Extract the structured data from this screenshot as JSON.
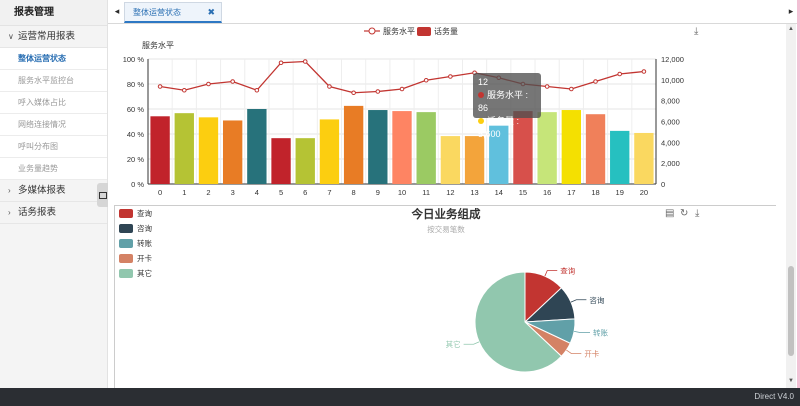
{
  "sidebar": {
    "title": "报表管理",
    "groups": [
      {
        "label": "运营常用报表",
        "expanded": true
      },
      {
        "label": "多媒体报表",
        "expanded": false
      },
      {
        "label": "话务报表",
        "expanded": false
      }
    ],
    "items": [
      {
        "label": "整体运营状态",
        "active": true
      },
      {
        "label": "服务水平监控台"
      },
      {
        "label": "呼入媒体占比"
      },
      {
        "label": "网络连接情况"
      },
      {
        "label": "呼叫分布图"
      },
      {
        "label": "业务量趋势"
      }
    ]
  },
  "tabs": {
    "prev": "◂",
    "next": "▸",
    "active_label": "整体运营状态",
    "close": "✖"
  },
  "chart_top": {
    "legend": [
      "服务水平",
      "话务量"
    ],
    "y_left_title": "服务水平",
    "tooltip": {
      "title": "12",
      "line1": "服务水平 : 86",
      "line2": "话务量 : 5,600"
    }
  },
  "chart_bottom": {
    "title": "今日业务组成",
    "subtitle": "按交易笔数",
    "legend": [
      "查询",
      "咨询",
      "转账",
      "开卡",
      "其它"
    ]
  },
  "footer": {
    "version": "Direct V4.0"
  },
  "colors": {
    "line": "#c23531",
    "bars": [
      "#c1232b",
      "#b5c334",
      "#fcce10",
      "#e87c25",
      "#27727b",
      "#c1232b",
      "#b5c334",
      "#fcce10",
      "#e87c25",
      "#27727b",
      "#fe8463",
      "#9bca63",
      "#fad860",
      "#f3a43b",
      "#60c0dd",
      "#d7504b",
      "#c6e579",
      "#f4e001",
      "#f0805a",
      "#26c0c0",
      "#fad860"
    ],
    "pie": [
      "#c23531",
      "#2f4554",
      "#61a0a8",
      "#d48265",
      "#91c7ae"
    ]
  },
  "chart_data": [
    {
      "type": "bar",
      "categories": [
        "0",
        "1",
        "2",
        "3",
        "4",
        "5",
        "6",
        "7",
        "8",
        "9",
        "10",
        "11",
        "12",
        "13",
        "14",
        "15",
        "16",
        "17",
        "18",
        "19",
        "20"
      ],
      "series": [
        {
          "name": "话务量",
          "type": "bar",
          "axis": "right",
          "values": [
            6500,
            6800,
            6400,
            6100,
            7200,
            4400,
            4400,
            6200,
            7500,
            7100,
            7000,
            6900,
            4600,
            4600,
            5600,
            7000,
            6900,
            7100,
            6700,
            5100,
            4900
          ]
        },
        {
          "name": "服务水平",
          "type": "line",
          "axis": "left",
          "values": [
            78,
            75,
            80,
            82,
            75,
            97,
            98,
            78,
            73,
            74,
            76,
            83,
            86,
            89,
            85,
            80,
            78,
            76,
            82,
            88,
            90
          ]
        }
      ],
      "y_left": {
        "min": 0,
        "max": 100,
        "ticks": [
          "0 %",
          "20 %",
          "40 %",
          "60 %",
          "80 %",
          "100 %"
        ]
      },
      "y_right": {
        "min": 0,
        "max": 12000,
        "ticks": [
          "0",
          "2,000",
          "4,000",
          "6,000",
          "8,000",
          "10,000",
          "12,000"
        ]
      },
      "grid": true,
      "legend_position": "top-center"
    },
    {
      "type": "pie",
      "title": "今日业务组成",
      "subtitle": "按交易笔数",
      "labels": [
        "查询",
        "咨询",
        "转账",
        "开卡",
        "其它"
      ],
      "values": [
        13,
        11,
        8,
        5,
        63
      ],
      "legend_position": "top-left"
    }
  ]
}
